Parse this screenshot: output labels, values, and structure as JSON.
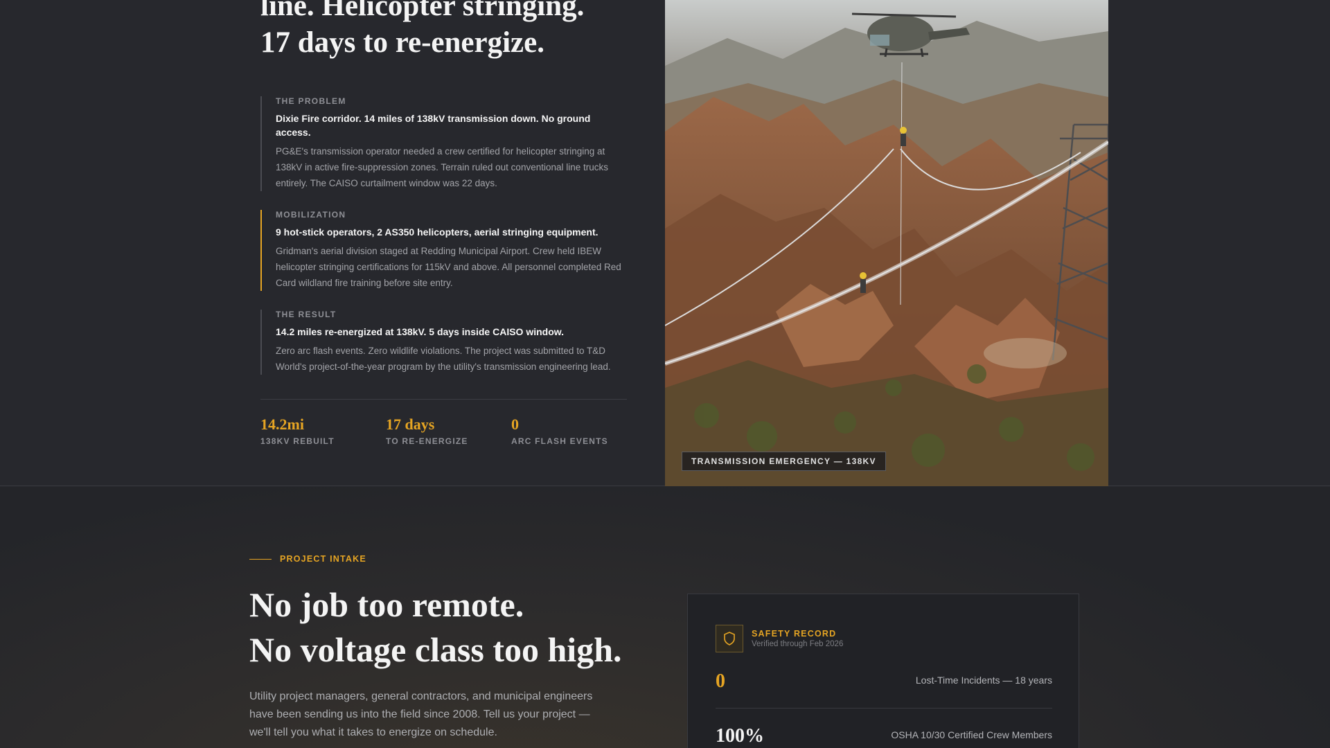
{
  "case_study": {
    "headline": [
      "line. Helicopter stringing.",
      "17 days to re-energize."
    ],
    "blocks": [
      {
        "kicker": "THE PROBLEM",
        "lead": "Dixie Fire corridor. 14 miles of 138kV transmission down. No ground access.",
        "body": "PG&E's transmission operator needed a crew certified for helicopter stringing at 138kV in active fire-suppression zones. Terrain ruled out conventional line trucks entirely. The CAISO curtailment window was 22 days."
      },
      {
        "kicker": "MOBILIZATION",
        "lead": "9 hot-stick operators, 2 AS350 helicopters, aerial stringing equipment.",
        "body": "Gridman's aerial division staged at Redding Municipal Airport. Crew held IBEW helicopter stringing certifications for 115kV and above. All personnel completed Red Card wildland fire training before site entry."
      },
      {
        "kicker": "THE RESULT",
        "lead": "14.2 miles re-energized at 138kV. 5 days inside CAISO window.",
        "body": "Zero arc flash events. Zero wildlife violations. The project was submitted to T&D World's project-of-the-year program by the utility's transmission engineering lead."
      }
    ],
    "stats": [
      {
        "value": "14.2mi",
        "label": "138KV REBUILT"
      },
      {
        "value": "17 days",
        "label": "TO RE-ENERGIZE"
      },
      {
        "value": "0",
        "label": "ARC FLASH EVENTS"
      }
    ],
    "photo_caption": "TRANSMISSION EMERGENCY — 138KV"
  },
  "intake": {
    "eyebrow": "PROJECT INTAKE",
    "title": [
      "No job too remote.",
      "No voltage class too high."
    ],
    "copy": "Utility project managers, general contractors, and municipal engineers have been sending us into the field since 2008. Tell us your project — we'll tell you what it takes to energize on schedule."
  },
  "safety_card": {
    "icon": "shield-icon",
    "title": "SAFETY RECORD",
    "subtitle": "Verified through Feb 2026",
    "rows": [
      {
        "value": "0",
        "label": "Lost-Time Incidents — 18 years"
      },
      {
        "value": "100%",
        "label": "OSHA 10/30 Certified Crew Members"
      }
    ]
  },
  "colors": {
    "accent": "#e6a523",
    "background": "#27282d"
  }
}
